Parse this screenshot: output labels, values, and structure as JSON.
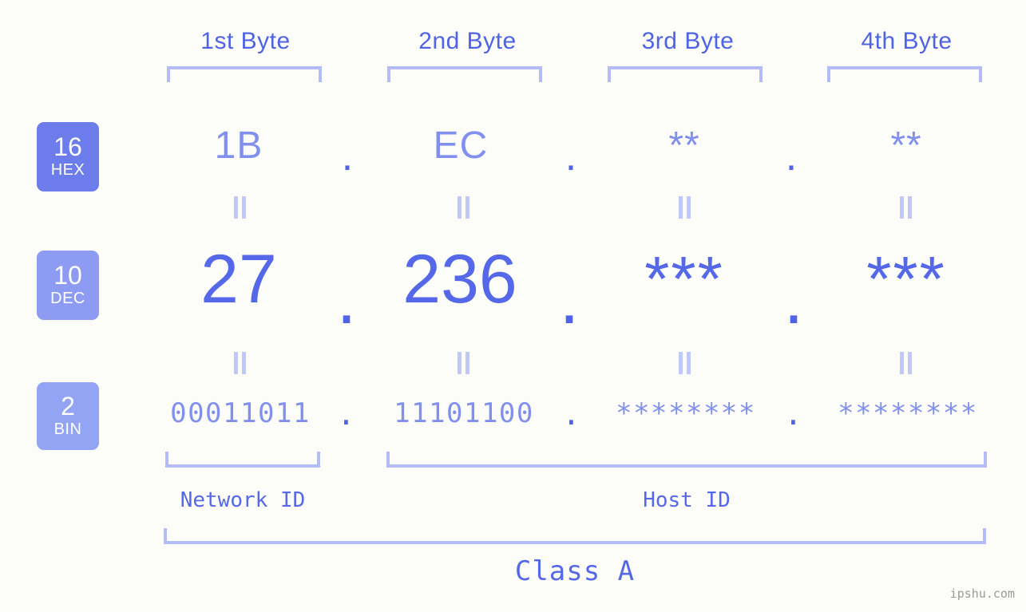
{
  "background_color": "#fcfdf8",
  "accent_color": "#5468e9",
  "accent_light_color": "#8190ef",
  "bracket_color": "#b3bcf7",
  "byte_headers": [
    {
      "label": "1st Byte"
    },
    {
      "label": "2nd Byte"
    },
    {
      "label": "3rd Byte"
    },
    {
      "label": "4th Byte"
    }
  ],
  "rows": [
    {
      "badge_number": "16",
      "badge_name": "HEX",
      "badge_color": "#6d7ceb",
      "values": [
        "1B",
        "EC",
        "**",
        "**"
      ],
      "separator": "."
    },
    {
      "badge_number": "10",
      "badge_name": "DEC",
      "badge_color": "#8d9bf2",
      "values": [
        "27",
        "236",
        "***",
        "***"
      ],
      "separator": "."
    },
    {
      "badge_number": "2",
      "badge_name": "BIN",
      "badge_color": "#93a4f5",
      "values": [
        "00011011",
        "11101100",
        "********",
        "********"
      ],
      "separator": "."
    }
  ],
  "equals_symbol": "=",
  "id_sections": [
    {
      "label": "Network ID"
    },
    {
      "label": "Host ID"
    }
  ],
  "class_label": "Class A",
  "watermark": "ipshu.com"
}
